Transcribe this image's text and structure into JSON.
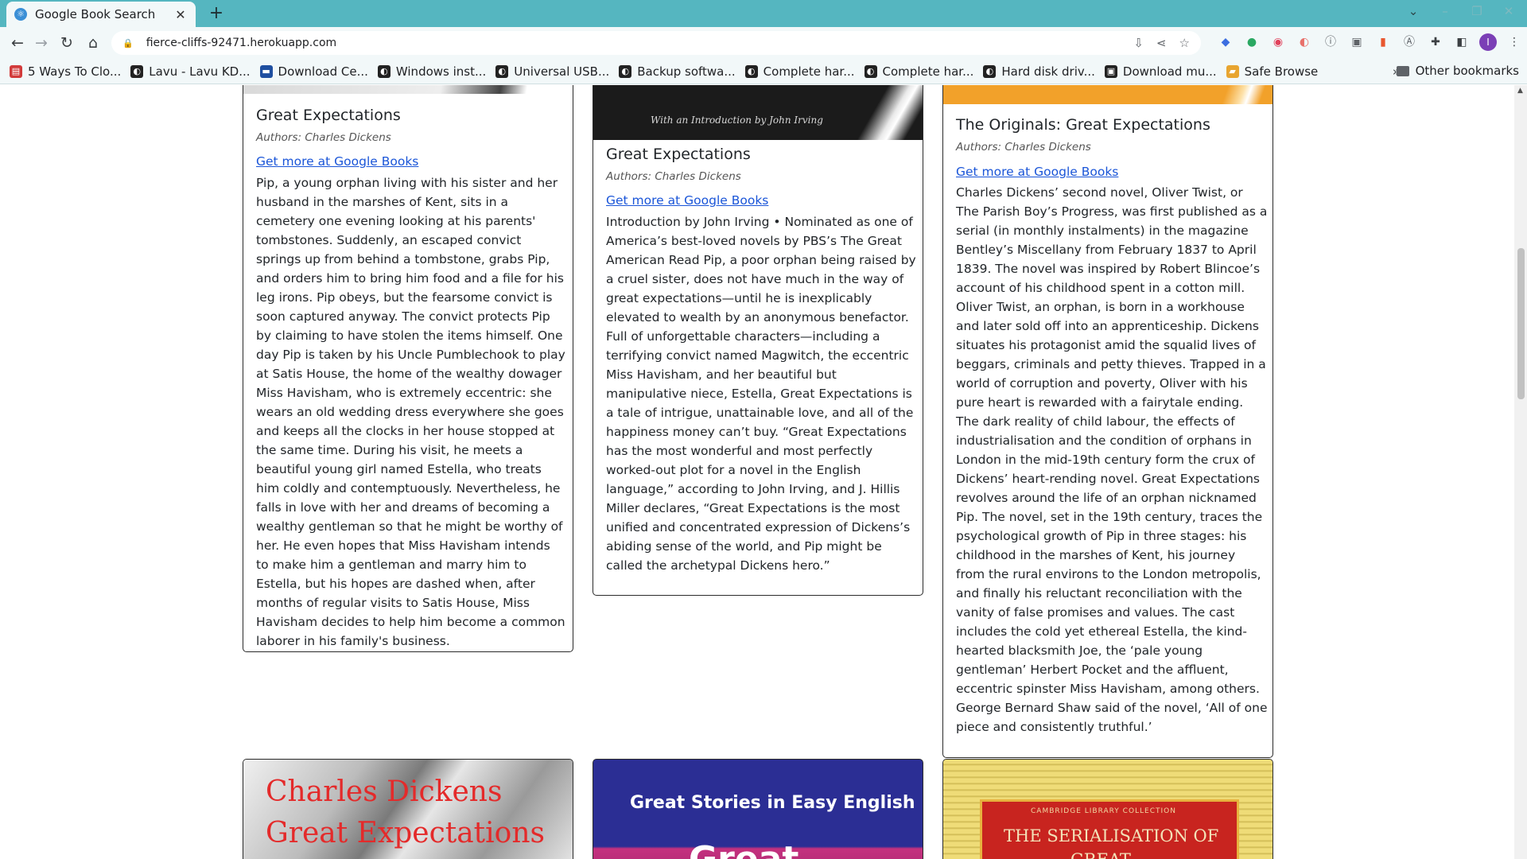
{
  "browser": {
    "tab_title": "Google Book Search",
    "url": "fierce-cliffs-92471.herokuapp.com",
    "new_tab_symbol": "+",
    "close_symbol": "✕"
  },
  "bookmarks": [
    {
      "label": "5 Ways To Clo...",
      "color": "#d23b3b"
    },
    {
      "label": "Lavu - Lavu KD...",
      "color": "#222222"
    },
    {
      "label": "Download Ce...",
      "color": "#1f4fa0"
    },
    {
      "label": "Windows inst...",
      "color": "#222222"
    },
    {
      "label": "Universal USB...",
      "color": "#222222"
    },
    {
      "label": "Backup softwa...",
      "color": "#222222"
    },
    {
      "label": "Complete har...",
      "color": "#222222"
    },
    {
      "label": "Complete har...",
      "color": "#222222"
    },
    {
      "label": "Hard disk driv...",
      "color": "#222222"
    },
    {
      "label": "Download mu...",
      "color": "#222222"
    },
    {
      "label": "Safe Browse",
      "color": "#e8a530"
    }
  ],
  "bookmarks_more": "»",
  "other_bookmarks": "Other bookmarks",
  "cards": [
    {
      "title": "Great Expectations",
      "authors": "Authors: Charles Dickens",
      "link": "Get more at Google Books",
      "description": "Pip, a young orphan living with his sister and her husband in the marshes of Kent, sits in a cemetery one evening looking at his parents' tombstones. Suddenly, an escaped convict springs up from behind a tombstone, grabs Pip, and orders him to bring him food and a file for his leg irons. Pip obeys, but the fearsome convict is soon captured anyway. The convict protects Pip by claiming to have stolen the items himself. One day Pip is taken by his Uncle Pumblechook to play at Satis House, the home of the wealthy dowager Miss Havisham, who is extremely eccentric: she wears an old wedding dress everywhere she goes and keeps all the clocks in her house stopped at the same time. During his visit, he meets a beautiful young girl named Estella, who treats him coldly and contemptuously. Nevertheless, he falls in love with her and dreams of becoming a wealthy gentleman so that he might be worthy of her. He even hopes that Miss Havisham intends to make him a gentleman and marry him to Estella, but his hopes are dashed when, after months of regular visits to Satis House, Miss Havisham decides to help him become a common laborer in his family's business."
    },
    {
      "title": "Great Expectations",
      "authors": "Authors: Charles Dickens",
      "link": "Get more at Google Books",
      "cover_text": "With an Introduction by John Irving",
      "description": "Introduction by John Irving • Nominated as one of America’s best-loved novels by PBS’s The Great American Read Pip, a poor orphan being raised by a cruel sister, does not have much in the way of great expectations—until he is inexplicably elevated to wealth by an anonymous benefactor. Full of unforgettable characters—including a terrifying convict named Magwitch, the eccentric Miss Havisham, and her beautiful but manipulative niece, Estella, Great Expectations is a tale of intrigue, unattainable love, and all of the happiness money can’t buy. “Great Expectations has the most wonderful and most perfectly worked-out plot for a novel in the English language,” according to John Irving, and J. Hillis Miller declares, “Great Expectations is the most unified and concentrated expression of Dickens’s abiding sense of the world, and Pip might be called the archetypal Dickens hero.”"
    },
    {
      "title": "The Originals: Great Expectations",
      "authors": "Authors: Charles Dickens",
      "link": "Get more at Google Books",
      "description": "Charles Dickens’ second novel, Oliver Twist, or The Parish Boy’s Progress, was first published as a serial (in monthly instalments) in the magazine Bentley’s Miscellany from February 1837 to April 1839. The novel was inspired by Robert Blincoe’s account of his childhood spent in a cotton mill. Oliver Twist, an orphan, is born in a workhouse and later sold off into an apprenticeship. Dickens situates his protagonist amid the squalid lives of beggars, criminals and petty thieves. Trapped in a world of corruption and poverty, Oliver with his pure heart is rewarded with a fairytale ending. The dark reality of child labour, the effects of industrialisation and the condition of orphans in London in the mid-19th century form the crux of Dickens’ heart-rending novel. Great Expectations revolves around the life of an orphan nicknamed Pip. The novel, set in the 19th century, traces the psychological growth of Pip in three stages: his childhood in the marshes of Kent, his journey from the rural environs to the London metropolis, and finally his reluctant reconciliation with the vanity of false promises and values. The cast includes the cold yet ethereal Estella, the kind-hearted blacksmith Joe, the ‘pale young gentleman’ Herbert Pocket and the affluent, eccentric spinster Miss Havisham, among others. George Bernard Shaw said of the novel, ‘All of one piece and consistently truthful.’"
    }
  ],
  "next_covers": [
    {
      "line1": "Charles Dickens",
      "line2": "Great Expectations"
    },
    {
      "line1": "Great Stories in Easy English",
      "line2": "Great"
    },
    {
      "line1": "CAMBRIDGE LIBRARY COLLECTION",
      "line2": "THE SERIALISATION OF",
      "line3": "GREAT"
    }
  ],
  "colors": {
    "tabbar": "#55b6c0",
    "link": "#1a55d8",
    "card_border": "#2a2a2a"
  }
}
